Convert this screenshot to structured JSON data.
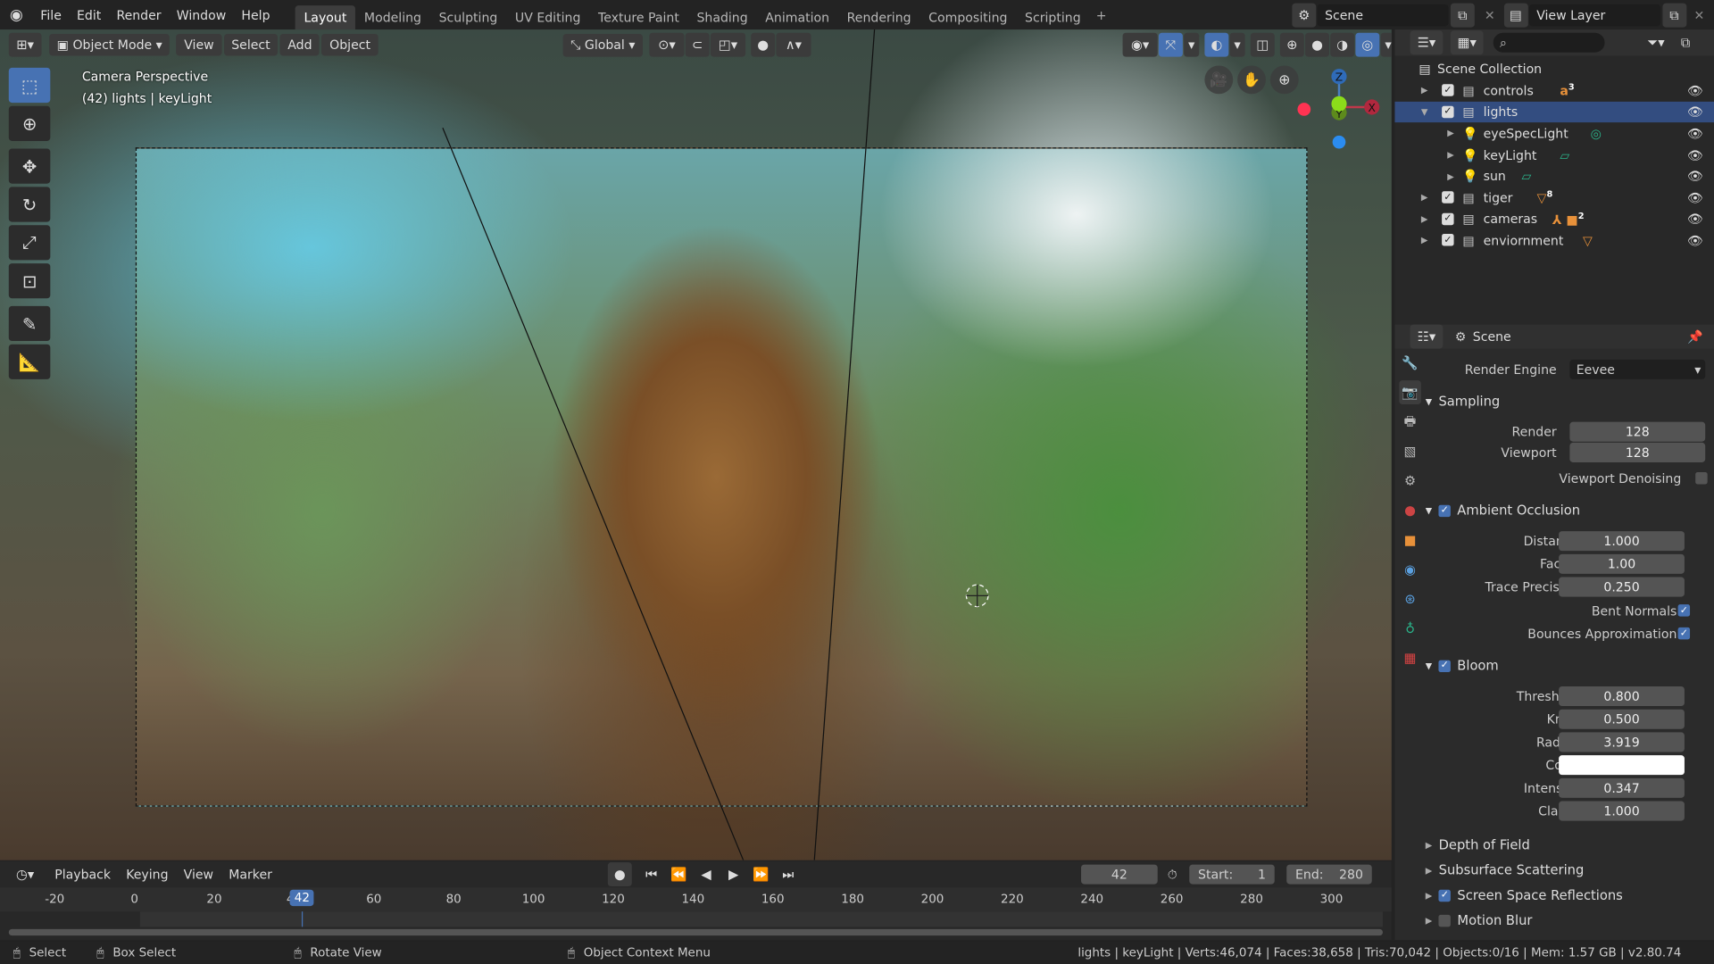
{
  "topbar": {
    "menus": [
      "File",
      "Edit",
      "Render",
      "Window",
      "Help"
    ],
    "workspaces": [
      "Layout",
      "Modeling",
      "Sculpting",
      "UV Editing",
      "Texture Paint",
      "Shading",
      "Animation",
      "Rendering",
      "Compositing",
      "Scripting"
    ],
    "active_workspace": "Layout",
    "add_tab": "+",
    "scene": "Scene",
    "view_layer": "View Layer"
  },
  "viewport": {
    "mode": "Object Mode",
    "menus": [
      "View",
      "Select",
      "Add",
      "Object"
    ],
    "orientation": "Global",
    "info_title": "Camera Perspective",
    "info_sub": "(42) lights | keyLight",
    "gizmo": {
      "x": "X",
      "y": "Y",
      "z": "Z"
    }
  },
  "outliner": {
    "root": "Scene Collection",
    "search_placeholder": "",
    "rows": [
      {
        "name": "controls",
        "level": 0,
        "expanded": false,
        "selected": false,
        "badge": "3",
        "icon_color": "#e8913a",
        "data_icon": "a"
      },
      {
        "name": "lights",
        "level": 0,
        "expanded": true,
        "selected": true,
        "badge": "",
        "icon_color": "",
        "data_icon": ""
      },
      {
        "name": "eyeSpecLight",
        "level": 1,
        "expanded": false,
        "selected": false,
        "badge": "",
        "icon_color": "#2bb38a",
        "data_icon": "◎"
      },
      {
        "name": "keyLight",
        "level": 1,
        "expanded": false,
        "selected": false,
        "badge": "",
        "icon_color": "#2bb38a",
        "data_icon": "▱"
      },
      {
        "name": "sun",
        "level": 1,
        "expanded": false,
        "selected": false,
        "badge": "",
        "icon_color": "#2bb38a",
        "data_icon": "▱"
      },
      {
        "name": "tiger",
        "level": 0,
        "expanded": false,
        "selected": false,
        "badge": "8",
        "icon_color": "#e8913a",
        "data_icon": "▽"
      },
      {
        "name": "cameras",
        "level": 0,
        "expanded": false,
        "selected": false,
        "badge": "2",
        "icon_color": "#e8913a",
        "data_icon": "⅄ ■"
      },
      {
        "name": "enviornment",
        "level": 0,
        "expanded": false,
        "selected": false,
        "badge": "",
        "icon_color": "#e8913a",
        "data_icon": "▽"
      }
    ]
  },
  "properties": {
    "context": "Scene",
    "render_engine_label": "Render Engine",
    "render_engine": "Eevee",
    "sampling": {
      "title": "Sampling",
      "render_label": "Render",
      "render": "128",
      "viewport_label": "Viewport",
      "viewport": "128",
      "denoise_label": "Viewport Denoising",
      "denoise": false
    },
    "ao": {
      "title": "Ambient Occlusion",
      "enabled": true,
      "distance_label": "Distance",
      "distance": "1.000",
      "factor_label": "Factor",
      "factor": "1.00",
      "factor_frac": 1.0,
      "precision_label": "Trace Precision",
      "precision": "0.250",
      "precision_frac": 0.25,
      "bent_label": "Bent Normals",
      "bent": true,
      "bounces_label": "Bounces Approximation",
      "bounces": true
    },
    "bloom": {
      "title": "Bloom",
      "enabled": true,
      "threshold_label": "Threshold",
      "threshold": "0.800",
      "threshold_frac": 0.08,
      "knee_label": "Knee",
      "knee": "0.500",
      "knee_frac": 0.5,
      "radius_label": "Radius",
      "radius": "3.919",
      "radius_frac": 0.39,
      "color_label": "Color",
      "color": "#ffffff",
      "intensity_label": "Intensity",
      "intensity": "0.347",
      "intensity_frac": 0.68,
      "clamp_label": "Clamp",
      "clamp": "1.000"
    },
    "collapsed": [
      {
        "title": "Depth of Field",
        "check": null
      },
      {
        "title": "Subsurface Scattering",
        "check": null
      },
      {
        "title": "Screen Space Reflections",
        "check": true
      },
      {
        "title": "Motion Blur",
        "check": false
      }
    ]
  },
  "timeline": {
    "menus": [
      "Playback",
      "Keying",
      "View",
      "Marker"
    ],
    "current_frame": "42",
    "start_label": "Start:",
    "start": "1",
    "end_label": "End:",
    "end": "280",
    "ticks": [
      "-20",
      "0",
      "20",
      "40",
      "60",
      "80",
      "100",
      "120",
      "140",
      "160",
      "180",
      "200",
      "220",
      "240",
      "260",
      "280",
      "300"
    ]
  },
  "statusbar": {
    "select": "Select",
    "box_select": "Box Select",
    "rotate": "Rotate View",
    "context_menu": "Object Context Menu",
    "stats": "lights | keyLight | Verts:46,074 | Faces:38,658 | Tris:70,042 | Objects:0/16 | Mem: 1.57 GB | v2.80.74"
  }
}
